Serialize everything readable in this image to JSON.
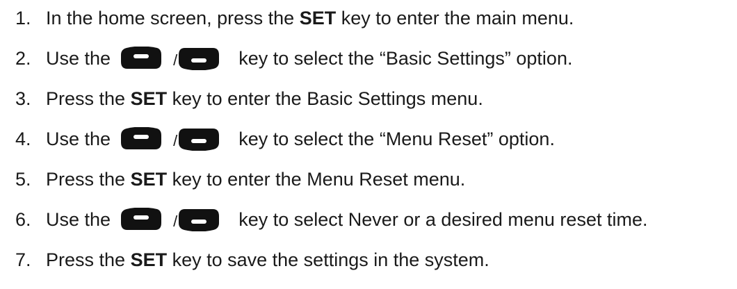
{
  "steps": [
    {
      "number": "1.",
      "text_before": "In the home screen, press the ",
      "bold": "SET",
      "text_after": " key to enter the main menu."
    },
    {
      "number": "2.",
      "text_before": "Use the",
      "keys": {
        "up_key_icon": "up-arrow-key-icon",
        "separator": "/",
        "down_key_icon": "down-arrow-key-icon"
      },
      "text_after": "key to select the “Basic Settings” option."
    },
    {
      "number": "3.",
      "text_before": "Press the ",
      "bold": "SET",
      "text_after": " key to enter the Basic Settings menu."
    },
    {
      "number": "4.",
      "text_before": "Use the",
      "keys": {
        "up_key_icon": "up-arrow-key-icon",
        "separator": "/",
        "down_key_icon": "down-arrow-key-icon"
      },
      "text_after": "key to select the “Menu Reset” option."
    },
    {
      "number": "5.",
      "text_before": "Press the ",
      "bold": "SET",
      "text_after": " key to enter the Menu Reset menu."
    },
    {
      "number": "6.",
      "text_before": "Use the",
      "keys": {
        "up_key_icon": "up-arrow-key-icon",
        "separator": "/",
        "down_key_icon": "down-arrow-key-icon"
      },
      "text_after": "key to select Never or a desired menu reset time."
    },
    {
      "number": "7.",
      "text_before": "Press the ",
      "bold": "SET",
      "text_after": " key to save the settings in the system."
    }
  ],
  "colors": {
    "text": "#1a1a1a",
    "key_body": "#111111",
    "key_symbol": "#ffffff"
  }
}
